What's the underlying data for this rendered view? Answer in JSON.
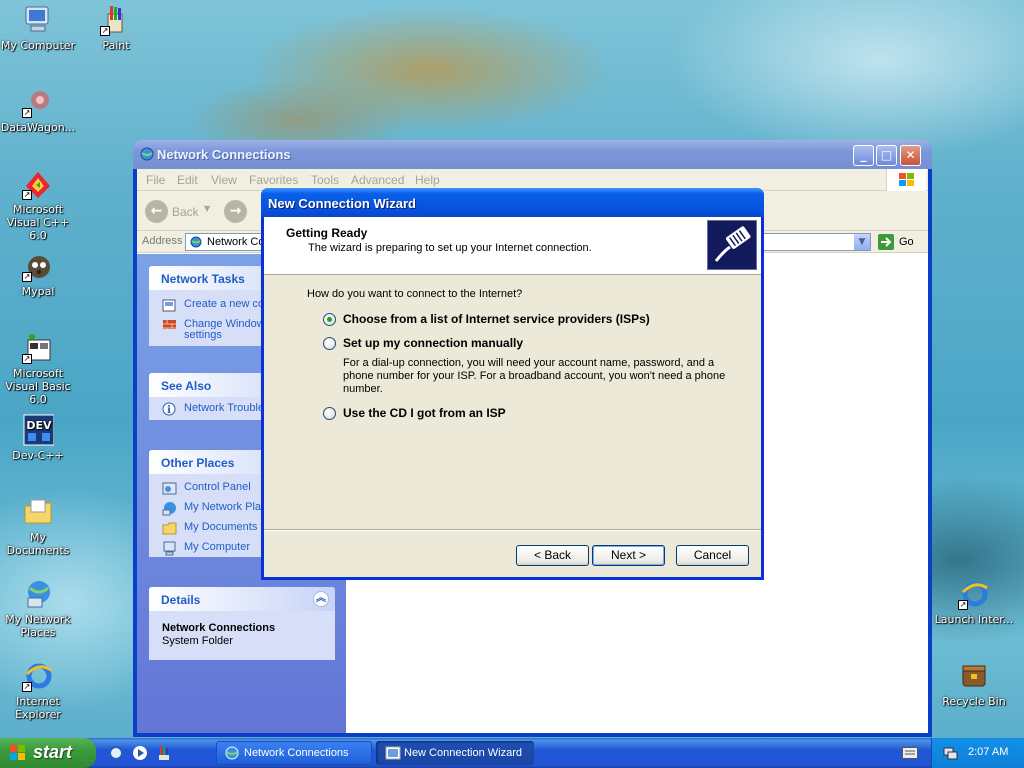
{
  "desktop": {
    "icons": [
      {
        "label": "My Computer"
      },
      {
        "label": "Paint"
      },
      {
        "label": "DataWagon..."
      },
      {
        "label": "Microsoft Visual C++ 6.0"
      },
      {
        "label": "Mypal"
      },
      {
        "label": "Microsoft Visual Basic 6.0"
      },
      {
        "label": "Dev-C++"
      },
      {
        "label": "My Documents"
      },
      {
        "label": "My Network Places"
      },
      {
        "label": "Internet Explorer"
      },
      {
        "label": "Launch Inter..."
      },
      {
        "label": "Recycle Bin"
      }
    ]
  },
  "explorer": {
    "title": "Network Connections",
    "menu": [
      "File",
      "Edit",
      "View",
      "Favorites",
      "Tools",
      "Advanced",
      "Help"
    ],
    "back_label": "Back",
    "address_label": "Address",
    "address_value": "Network Co",
    "go_label": "Go",
    "network_tasks": {
      "header": "Network Tasks",
      "items": [
        "Create a new co",
        "Change Window",
        "settings"
      ]
    },
    "see_also": {
      "header": "See Also",
      "items": [
        "Network Trouble"
      ]
    },
    "other_places": {
      "header": "Other Places",
      "items": [
        "Control Panel",
        "My Network Plac",
        "My Documents",
        "My Computer"
      ]
    },
    "details": {
      "header": "Details",
      "name": "Network Connections",
      "type": "System Folder"
    }
  },
  "wizard": {
    "title": "New Connection Wizard",
    "heading": "Getting Ready",
    "subheading": "The wizard is preparing to set up your Internet connection.",
    "question": "How do you want to connect to the Internet?",
    "options": [
      {
        "label": "Choose from a list of Internet service providers (ISPs)",
        "selected": true
      },
      {
        "label": "Set up my connection manually",
        "selected": false
      },
      {
        "label": "Use the CD I got from an ISP",
        "selected": false
      }
    ],
    "manual_description": "For a dial-up connection, you will need your account name, password, and a phone number for your ISP. For a broadband account, you won't need a phone number.",
    "buttons": {
      "back": "< Back",
      "next": "Next >",
      "cancel": "Cancel"
    }
  },
  "taskbar": {
    "start_label": "start",
    "tasks": [
      {
        "label": "Network Connections",
        "active": false
      },
      {
        "label": "New Connection Wizard",
        "active": true
      }
    ],
    "clock": "2:07 AM"
  }
}
